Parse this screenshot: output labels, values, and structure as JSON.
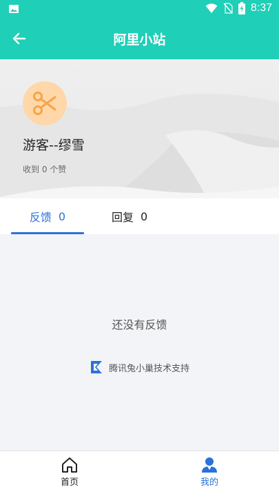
{
  "status_bar": {
    "time": "8:37",
    "icons": [
      "image-icon",
      "wifi-icon",
      "no-sim-icon",
      "battery-charging-icon"
    ]
  },
  "app_bar": {
    "title": "阿里小站",
    "back_icon": "arrow-left-icon"
  },
  "profile": {
    "avatar_icon": "scissors-icon",
    "username": "游客--缪雪",
    "likes_text": "收到 0 个赞"
  },
  "tabs": [
    {
      "label": "反馈",
      "count": "0",
      "active": true
    },
    {
      "label": "回复",
      "count": "0",
      "active": false
    }
  ],
  "content": {
    "empty_text": "还没有反馈",
    "support_text": "腾讯兔小巢技术支持"
  },
  "bottom_nav": {
    "items": [
      {
        "label": "首页",
        "icon": "home-icon",
        "active": false
      },
      {
        "label": "我的",
        "icon": "person-icon",
        "active": true
      }
    ]
  },
  "colors": {
    "primary": "#1fcfb7",
    "accent": "#2a72d9",
    "avatar_bg": "#ffd7a8",
    "avatar_icon": "#f7a44a"
  }
}
